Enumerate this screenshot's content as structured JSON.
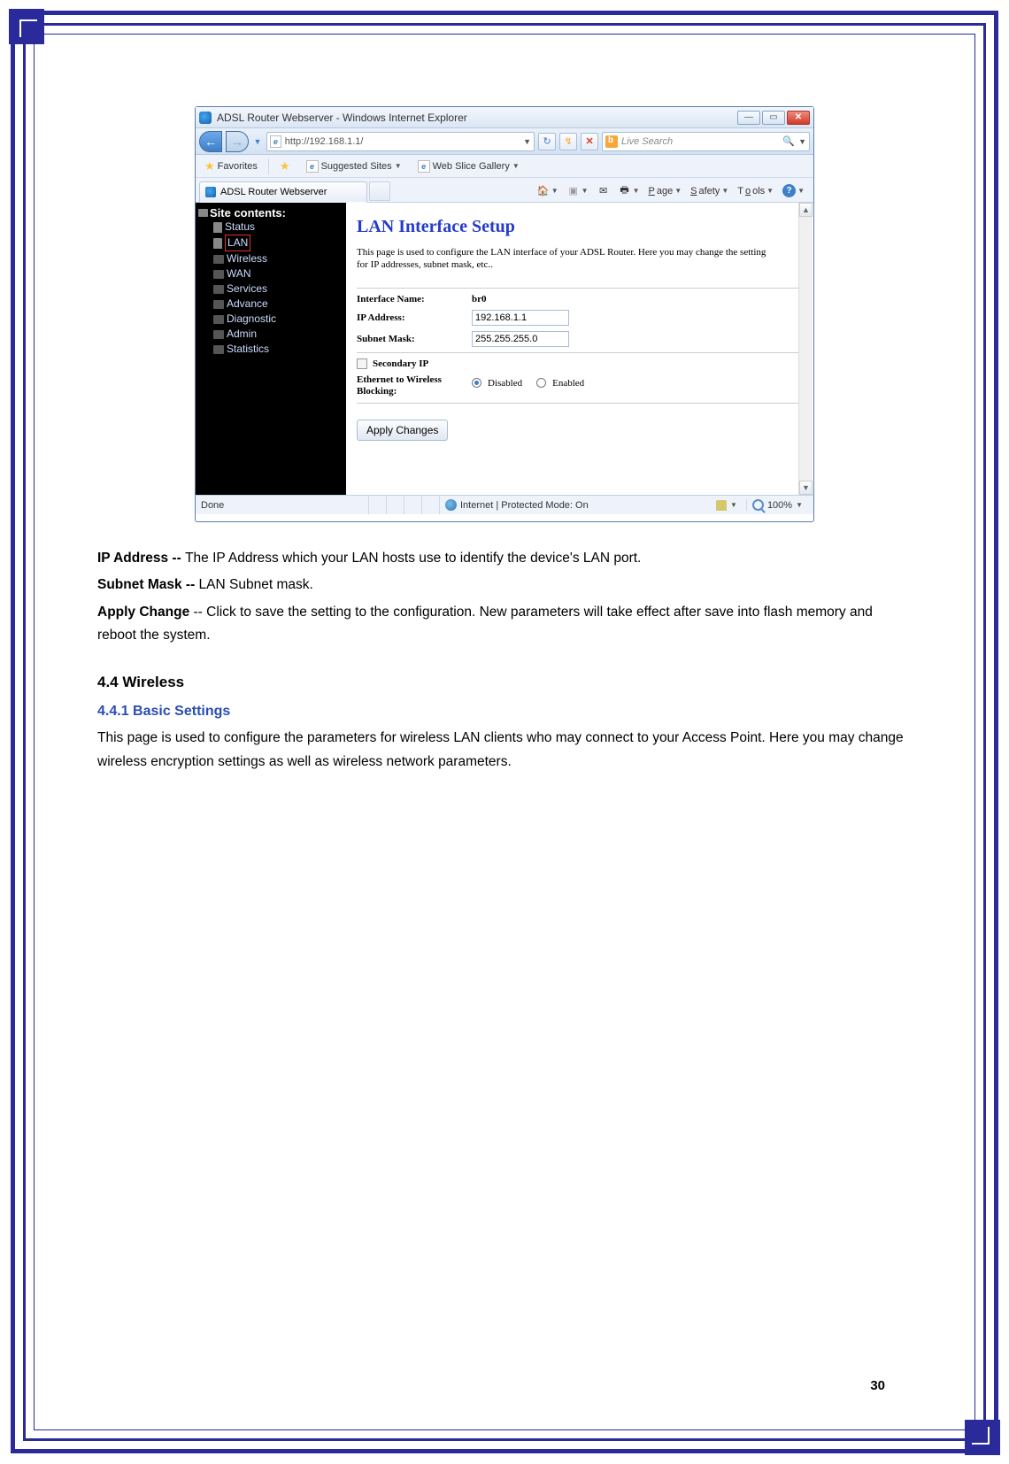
{
  "page_number": "30",
  "browser": {
    "title": "ADSL Router Webserver - Windows Internet Explorer",
    "url": "http://192.168.1.1/",
    "search_placeholder": "Live Search",
    "favorites_label": "Favorites",
    "suggested_label": "Suggested Sites",
    "webslice_label": "Web Slice Gallery",
    "tab_title": "ADSL Router Webserver",
    "cmd_page": "Page",
    "cmd_safety": "Safety",
    "cmd_tools": "Tools",
    "status_done": "Done",
    "status_zone": "Internet | Protected Mode: On",
    "zoom": "100%"
  },
  "sidebar": {
    "root": "Site contents:",
    "items": [
      "Status",
      "LAN",
      "Wireless",
      "WAN",
      "Services",
      "Advance",
      "Diagnostic",
      "Admin",
      "Statistics"
    ]
  },
  "router": {
    "title": "LAN Interface Setup",
    "desc": "This page is used to configure the LAN interface of your ADSL Router. Here you may change the setting for IP addresses, subnet mask, etc..",
    "interface_name_label": "Interface Name:",
    "interface_name": "br0",
    "ip_label": "IP Address:",
    "ip_value": "192.168.1.1",
    "subnet_label": "Subnet Mask:",
    "subnet_value": "255.255.255.0",
    "secondary_ip": "Secondary IP",
    "eth_block_label": "Ethernet to Wireless Blocking:",
    "disabled": "Disabled",
    "enabled": "Enabled",
    "apply_btn": "Apply Changes"
  },
  "doc": {
    "ip_label": "IP Address -- ",
    "ip_text": "The IP Address which your LAN hosts use to identify the device's LAN port.",
    "subnet_label": "Subnet Mask -- ",
    "subnet_text": "LAN Subnet mask.",
    "apply_label": "Apply Change ",
    "apply_text": "-- Click to save the setting to the configuration. New parameters will take effect after save into flash memory and reboot the system.",
    "section_heading": "4.4 Wireless",
    "subsection_heading": "4.4.1 Basic Settings",
    "wireless_para": "This page is used to configure the parameters for wireless LAN clients who may connect to your Access Point. Here you may change wireless encryption settings as well as wireless network parameters."
  }
}
